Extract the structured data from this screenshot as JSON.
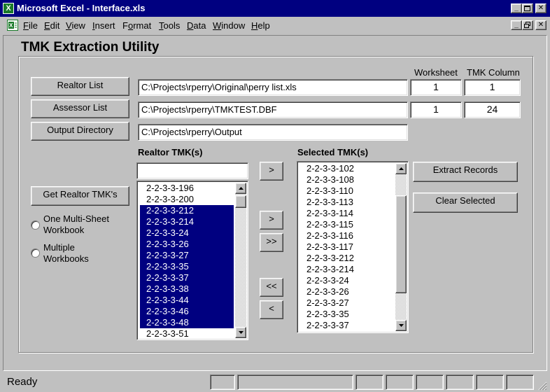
{
  "window": {
    "title": "Microsoft Excel - Interface.xls",
    "app_icon": "excel-icon"
  },
  "menu": {
    "items": [
      "File",
      "Edit",
      "View",
      "Insert",
      "Format",
      "Tools",
      "Data",
      "Window",
      "Help"
    ],
    "mnemonics": [
      "F",
      "E",
      "V",
      "I",
      "o",
      "T",
      "D",
      "W",
      "H"
    ]
  },
  "form": {
    "title": "TMK Extraction Utility",
    "worksheet_header": "Worksheet",
    "tmk_column_header": "TMK Column",
    "realtor_list_button": "Realtor List",
    "assessor_list_button": "Assessor List",
    "output_directory_button": "Output Directory",
    "realtor_list_path": "C:\\Projects\\rperry\\Original\\perry list.xls",
    "assessor_list_path": "C:\\Projects\\rperry\\TMKTEST.DBF",
    "output_directory_path": "C:\\Projects\\rperry\\Output",
    "realtor_worksheet": "1",
    "realtor_tmk_column": "1",
    "assessor_worksheet": "1",
    "assessor_tmk_column": "24",
    "realtor_tmks_label": "Realtor TMK(s)",
    "selected_tmks_label": "Selected TMK(s)",
    "realtor_filter_value": "",
    "get_realtor_tmks_button": "Get Realtor TMK's",
    "option_one_workbook": "One Multi-Sheet Workbook",
    "option_multiple_workbooks": "Multiple Workbooks",
    "add_filter_button": ">",
    "add_button": ">",
    "add_all_button": ">>",
    "remove_all_button": "<<",
    "remove_button": "<",
    "extract_records_button": "Extract Records",
    "clear_selected_button": "Clear Selected",
    "realtor_tmks": [
      {
        "value": "2-2-3-3-196",
        "selected": false
      },
      {
        "value": "2-2-3-3-200",
        "selected": false
      },
      {
        "value": "2-2-3-3-212",
        "selected": true
      },
      {
        "value": "2-2-3-3-214",
        "selected": true
      },
      {
        "value": "2-2-3-3-24",
        "selected": true
      },
      {
        "value": "2-2-3-3-26",
        "selected": true
      },
      {
        "value": "2-2-3-3-27",
        "selected": true
      },
      {
        "value": "2-2-3-3-35",
        "selected": true
      },
      {
        "value": "2-2-3-3-37",
        "selected": true
      },
      {
        "value": "2-2-3-3-38",
        "selected": true
      },
      {
        "value": "2-2-3-3-44",
        "selected": true
      },
      {
        "value": "2-2-3-3-46",
        "selected": true
      },
      {
        "value": "2-2-3-3-48",
        "selected": true
      },
      {
        "value": "2-2-3-3-51",
        "selected": false
      }
    ],
    "selected_tmks": [
      "2-2-3-3-102",
      "2-2-3-3-108",
      "2-2-3-3-110",
      "2-2-3-3-113",
      "2-2-3-3-114",
      "2-2-3-3-115",
      "2-2-3-3-116",
      "2-2-3-3-117",
      "2-2-3-3-212",
      "2-2-3-3-214",
      "2-2-3-3-24",
      "2-2-3-3-26",
      "2-2-3-3-27",
      "2-2-3-3-35",
      "2-2-3-3-37"
    ]
  },
  "status": {
    "text": "Ready"
  },
  "colors": {
    "titlebar": "#000080",
    "face": "#c0c0c0",
    "selection": "#000080"
  }
}
